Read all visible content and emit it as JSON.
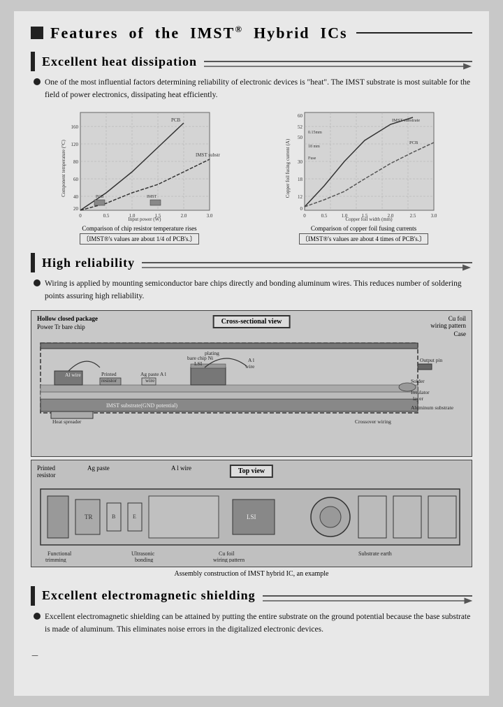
{
  "page": {
    "main_title": "Features of the IMST",
    "main_title_reg": "®",
    "main_title_rest": " Hybrid ICs",
    "sections": [
      {
        "id": "heat",
        "title": "Excellent heat dissipation",
        "bullet": "One of the most influential factors determining reliability of electronic devices is \"heat\". The IMST substrate is most suitable for the field of power electronics, dissipating heat efficiently.",
        "chart1_caption": "Comparison of chip resistor temperature rises",
        "chart1_bracket": "〔IMST®'s values are about 1/4 of PCB's.〕",
        "chart2_caption": "Comparison of copper foil fusing currents",
        "chart2_bracket": "〔IMST®'s values are about 4 times of PCB's.〕"
      },
      {
        "id": "reliability",
        "title": "High reliability",
        "bullet": "Wiring is applied by mounting semiconductor bare chips directly and bonding aluminum wires. This reduces number of soldering points assuring high reliability.",
        "cross_section_label": "Cross-sectional view",
        "top_view_label": "Top view",
        "diagram_labels": [
          "Hollow closed package",
          "Power Tr bare chip",
          "Al wire",
          "Printed resistor",
          "Ag paste",
          "A l",
          "wire",
          "LSI bare chip",
          "Ni plating",
          "A l wire",
          "Cu foil wiring pattern",
          "Case",
          "Output pin",
          "Solder",
          "Insulator layer",
          "Aluminum substrate",
          "Heat spreader",
          "IMST substrate(GND potential)",
          "Crossover wiring",
          "Printed resistor",
          "Ag paste",
          "A l wire",
          "Functional trimming",
          "Ultrasonic bonding",
          "Cu foil wiring pattern",
          "Substrate earth"
        ],
        "assembly_caption": "Assembly construction of IMST hybrid IC, an example"
      },
      {
        "id": "shielding",
        "title": "Excellent electromagnetic shielding",
        "bullet": "Excellent electromagnetic shielding can be attained by putting the entire substrate on the ground potential because the base substrate is made of aluminum. This eliminates noise errors in the digitalized electronic devices."
      }
    ]
  }
}
